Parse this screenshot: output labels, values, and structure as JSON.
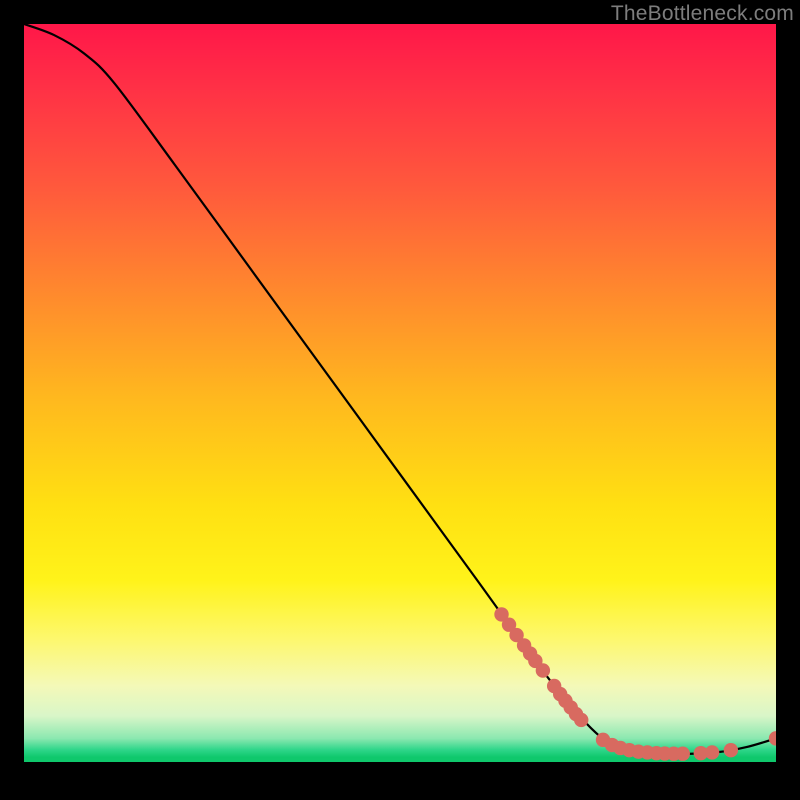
{
  "attribution": "TheBottleneck.com",
  "colors": {
    "curve_stroke": "#000000",
    "marker_fill": "#d86a60",
    "marker_stroke": "#c45a52"
  },
  "chart_data": {
    "type": "line",
    "title": "",
    "xlabel": "",
    "ylabel": "",
    "xlim": [
      0,
      100
    ],
    "ylim": [
      0,
      100
    ],
    "curve": [
      {
        "x": 0,
        "y": 100
      },
      {
        "x": 4,
        "y": 98.5
      },
      {
        "x": 8,
        "y": 96
      },
      {
        "x": 12,
        "y": 92
      },
      {
        "x": 20,
        "y": 81
      },
      {
        "x": 30,
        "y": 67
      },
      {
        "x": 40,
        "y": 53
      },
      {
        "x": 50,
        "y": 39
      },
      {
        "x": 60,
        "y": 25
      },
      {
        "x": 70,
        "y": 11
      },
      {
        "x": 76,
        "y": 4
      },
      {
        "x": 80,
        "y": 1.5
      },
      {
        "x": 86,
        "y": 1.1
      },
      {
        "x": 92,
        "y": 1.3
      },
      {
        "x": 96,
        "y": 2.0
      },
      {
        "x": 100,
        "y": 3.2
      }
    ],
    "markers": [
      {
        "x": 63.5,
        "y": 20.0
      },
      {
        "x": 64.5,
        "y": 18.6
      },
      {
        "x": 65.5,
        "y": 17.2
      },
      {
        "x": 66.5,
        "y": 15.8
      },
      {
        "x": 67.3,
        "y": 14.7
      },
      {
        "x": 68.0,
        "y": 13.7
      },
      {
        "x": 69.0,
        "y": 12.4
      },
      {
        "x": 70.5,
        "y": 10.3
      },
      {
        "x": 71.3,
        "y": 9.2
      },
      {
        "x": 72.0,
        "y": 8.3
      },
      {
        "x": 72.7,
        "y": 7.4
      },
      {
        "x": 73.4,
        "y": 6.5
      },
      {
        "x": 74.1,
        "y": 5.7
      },
      {
        "x": 77.0,
        "y": 3.0
      },
      {
        "x": 78.2,
        "y": 2.3
      },
      {
        "x": 79.3,
        "y": 1.9
      },
      {
        "x": 80.5,
        "y": 1.6
      },
      {
        "x": 81.7,
        "y": 1.4
      },
      {
        "x": 82.9,
        "y": 1.3
      },
      {
        "x": 84.1,
        "y": 1.2
      },
      {
        "x": 85.2,
        "y": 1.15
      },
      {
        "x": 86.4,
        "y": 1.12
      },
      {
        "x": 87.6,
        "y": 1.12
      },
      {
        "x": 90.0,
        "y": 1.2
      },
      {
        "x": 91.5,
        "y": 1.3
      },
      {
        "x": 94.0,
        "y": 1.6
      },
      {
        "x": 100.0,
        "y": 3.2
      }
    ]
  }
}
